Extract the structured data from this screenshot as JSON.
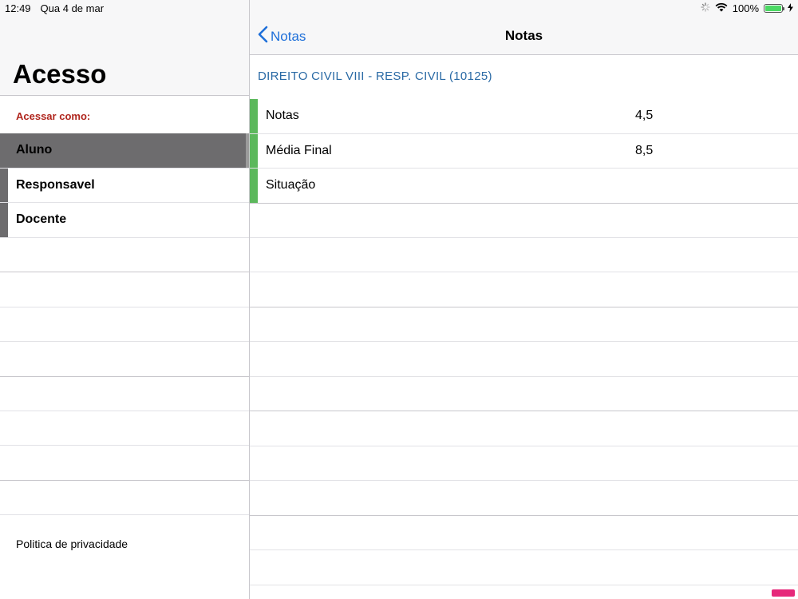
{
  "status_bar": {
    "time": "12:49",
    "date": "Qua 4 de mar",
    "battery_percent": "100%",
    "battery_level": 1.0,
    "battery_color": "#4cd964"
  },
  "left": {
    "title": "Acesso",
    "section_label": "Acessar como:",
    "items": [
      {
        "label": "Aluno",
        "selected": true
      },
      {
        "label": "Responsavel",
        "selected": false
      },
      {
        "label": "Docente",
        "selected": false
      }
    ],
    "privacy_link": "Politica de privacidade"
  },
  "right": {
    "back_label": "Notas",
    "nav_title": "Notas",
    "course_title": "DIREITO CIVIL VIII - RESP. CIVIL (10125)",
    "rows": [
      {
        "label": "Notas",
        "value": "4,5"
      },
      {
        "label": "Média Final",
        "value": "8,5"
      },
      {
        "label": "Situação",
        "value": ""
      }
    ]
  },
  "colors": {
    "accent_blue": "#1e6fd9",
    "section_red": "#b0261e",
    "selected_gray": "#6d6c6e",
    "grade_green": "#5cb85c"
  },
  "icons": {
    "back": "chevron-left-icon",
    "wifi": "wifi-icon",
    "activity": "activity-spinner-icon",
    "battery": "battery-icon",
    "charging": "charging-bolt-icon"
  }
}
